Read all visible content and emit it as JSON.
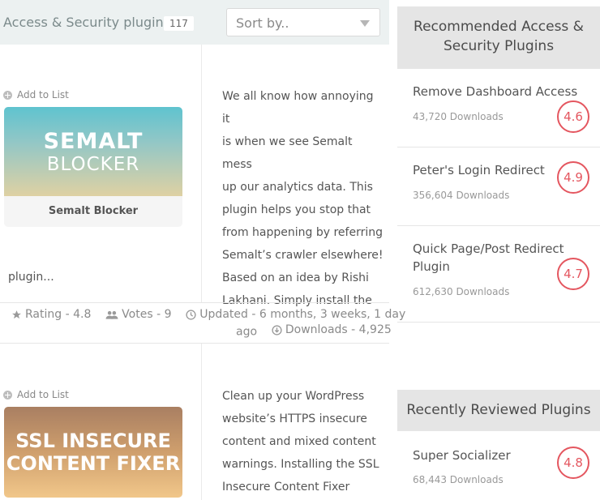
{
  "header": {
    "title": "Access & Security plugins",
    "count": "117",
    "sort_label": "Sort by.."
  },
  "plugins": [
    {
      "add_label": "Add to List",
      "thumb_line1": "SEMALT",
      "thumb_line2": "BLOCKER",
      "caption": "Semalt Blocker",
      "desc_lines": [
        "We all know how annoying it",
        "is when we see Semalt mess",
        "up our analytics data. This",
        "plugin helps you stop that",
        "from happening by referring",
        "Semalt’s crawler elsewhere!",
        "Based on an idea by Rishi",
        "Lakhani. Simply install the"
      ],
      "desc_overflow": "plugin...",
      "rating": "Rating - 4.8",
      "votes": "Votes - 9",
      "updated": "Updated - 6 months, 3 weeks, 1 day",
      "updated_cont": "ago",
      "downloads": "Downloads - 4,925"
    },
    {
      "add_label": "Add to List",
      "thumb_line1": "SSL INSECURE",
      "thumb_line2": "CONTENT FIXER",
      "caption": "",
      "desc_lines": [
        "Clean up your WordPress",
        "website’s HTTPS insecure",
        "content and mixed content",
        "warnings. Installing the SSL",
        "Insecure Content Fixer"
      ]
    }
  ],
  "sidebar": {
    "recommended_title_line1": "Recommended Access &",
    "recommended_title_line2": "Security Plugins",
    "recommended": [
      {
        "name": "Remove Dashboard Access",
        "downloads": "43,720 Downloads",
        "rating": "4.6"
      },
      {
        "name": "Peter's Login Redirect",
        "downloads": "356,604 Downloads",
        "rating": "4.9"
      },
      {
        "name_line1": "Quick Page/Post Redirect",
        "name_line2": "Plugin",
        "downloads": "612,630 Downloads",
        "rating": "4.7"
      }
    ],
    "reviewed_title": "Recently Reviewed Plugins",
    "reviewed": [
      {
        "name": "Super Socializer",
        "downloads": "68,443 Downloads",
        "rating": "4.8"
      }
    ]
  },
  "colors": {
    "accent_red": "#e4565f",
    "header_bg": "#ecf1f1",
    "sidebar_head_bg": "#e5e5e5"
  },
  "icons": [
    "plus-circle-icon",
    "star-icon",
    "users-icon",
    "clock-icon",
    "download-icon",
    "chevron-down-icon"
  ]
}
